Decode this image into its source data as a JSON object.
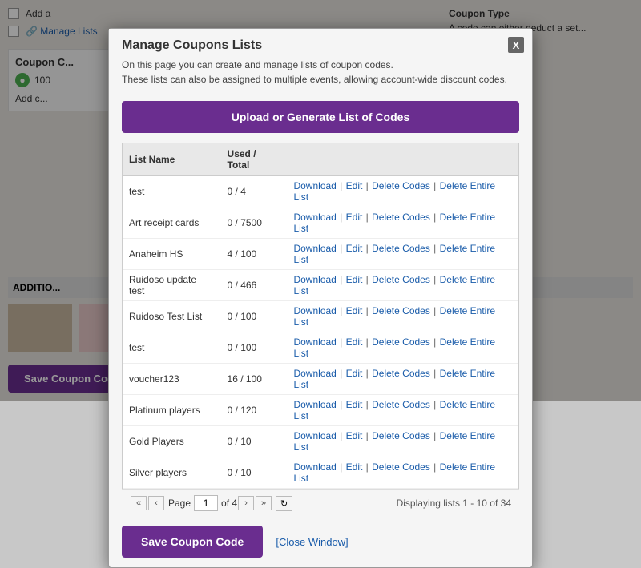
{
  "background": {
    "rows": [
      {
        "label": "Add a...",
        "hasCheckbox": true
      },
      {
        "label": "Manage Lists",
        "hasCheckbox": false,
        "isLink": true
      }
    ],
    "coupon_section": {
      "title": "Coupon C...",
      "badge": "100",
      "add_label": "Add c..."
    },
    "right_section": {
      "coupon_type_label": "Coupon Type",
      "coupon_type_desc": "A code can either deduct a set..."
    },
    "additional_section": {
      "title": "ADDITIO..."
    }
  },
  "modal": {
    "title": "Manage Coupons Lists",
    "description_line1": "On this page you can create and manage lists of coupon codes.",
    "description_line2": "These lists can also be assigned to multiple events, allowing account-wide discount codes.",
    "close_btn_label": "X",
    "upload_btn_label": "Upload or Generate List of Codes",
    "table": {
      "columns": [
        "List Name",
        "Used / Total",
        ""
      ],
      "rows": [
        {
          "name": "test",
          "used_total": "0 / 4",
          "actions": [
            "Download",
            "Edit",
            "Delete Codes",
            "Delete Entire List"
          ]
        },
        {
          "name": "Art receipt cards",
          "used_total": "0 / 7500",
          "actions": [
            "Download",
            "Edit",
            "Delete Codes",
            "Delete Entire List"
          ]
        },
        {
          "name": "Anaheim HS",
          "used_total": "4 / 100",
          "actions": [
            "Download",
            "Edit",
            "Delete Codes",
            "Delete Entire List"
          ]
        },
        {
          "name": "Ruidoso update test",
          "used_total": "0 / 466",
          "actions": [
            "Download",
            "Edit",
            "Delete Codes",
            "Delete Entire List"
          ]
        },
        {
          "name": "Ruidoso Test List",
          "used_total": "0 / 100",
          "actions": [
            "Download",
            "Edit",
            "Delete Codes",
            "Delete Entire List"
          ]
        },
        {
          "name": "test",
          "used_total": "0 / 100",
          "actions": [
            "Download",
            "Edit",
            "Delete Codes",
            "Delete Entire List"
          ]
        },
        {
          "name": "voucher123",
          "used_total": "16 / 100",
          "actions": [
            "Download",
            "Edit",
            "Delete Codes",
            "Delete Entire List"
          ]
        },
        {
          "name": "Platinum players",
          "used_total": "0 / 120",
          "actions": [
            "Download",
            "Edit",
            "Delete Codes",
            "Delete Entire List"
          ]
        },
        {
          "name": "Gold Players",
          "used_total": "0 / 10",
          "actions": [
            "Download",
            "Edit",
            "Delete Codes",
            "Delete Entire List"
          ]
        },
        {
          "name": "Silver players",
          "used_total": "0 / 10",
          "actions": [
            "Download",
            "Edit",
            "Delete Codes",
            "Delete Entire List"
          ]
        }
      ]
    },
    "pagination": {
      "first_btn": "«",
      "prev_btn": "‹",
      "page_label": "Page",
      "current_page": "1",
      "of_label": "of 4",
      "next_btn": "›",
      "last_btn": "»",
      "refresh_btn": "↻",
      "display_info": "Displaying lists 1 - 10 of 34"
    },
    "footer": {
      "save_btn_label": "Save Coupon Code",
      "close_link_label": "[Close Window]"
    }
  }
}
